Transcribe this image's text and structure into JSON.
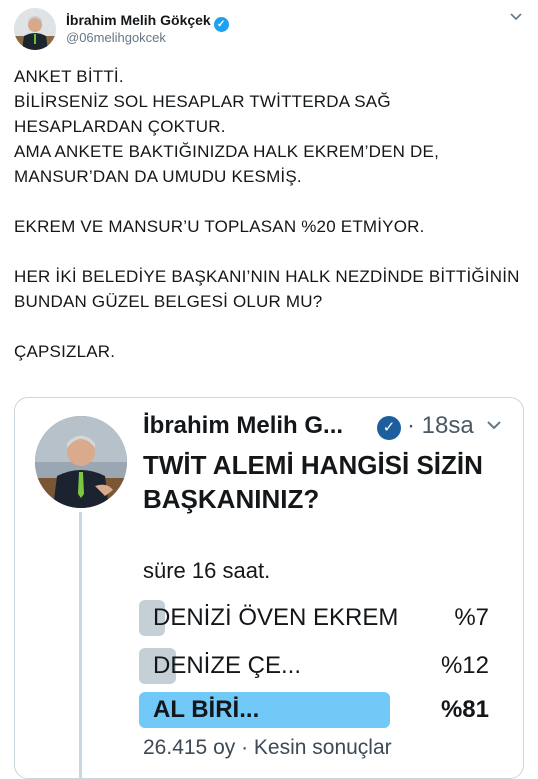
{
  "author": {
    "name": "İbrahim Melih Gökçek",
    "handle": "@06melihgokcek"
  },
  "tweet": {
    "text": "ANKET BİTTİ.\nBİLİRSENİZ SOL HESAPLAR TWİTTERDA SAĞ HESAPLARDAN ÇOKTUR.\nAMA ANKETE BAKTIĞINIZDA HALK EKREM’DEN DE, MANSUR’DAN DA UMUDU KESMİŞ.\n\nEKREM VE MANSUR’U TOPLASAN %20 ETMİYOR.\n\nHER İKİ BELEDİYE BAŞKANI’NIN HALK NEZDİNDE BİTTİĞİNİN BUNDAN GÜZEL BELGESİ OLUR MU?\n\nÇAPSIZLAR."
  },
  "embedded": {
    "name": "İbrahim Melih G...",
    "time": "· 18sa",
    "question": "TWİT ALEMİ HANGİSİ SİZİN BAŞKANINIZ?",
    "duration": "süre 16 saat.",
    "options": [
      {
        "label": "DENİZİ ÖVEN EKREM",
        "percent": "%7",
        "fraction": 0.07
      },
      {
        "label": "DENİZE ÇE...",
        "percent": "%12",
        "fraction": 0.12
      },
      {
        "label": "AL BİRİ...",
        "percent": "%81",
        "fraction": 0.81
      }
    ],
    "footer": "26.415 oy · Kesin sonuçlar"
  },
  "colors": {
    "verified": "#1da1f2",
    "bar_loser": "#c4cfd6",
    "bar_winner": "#71c9f8"
  },
  "icons": {
    "verified": "verified-badge-icon",
    "menu": "chevron-down-icon"
  }
}
